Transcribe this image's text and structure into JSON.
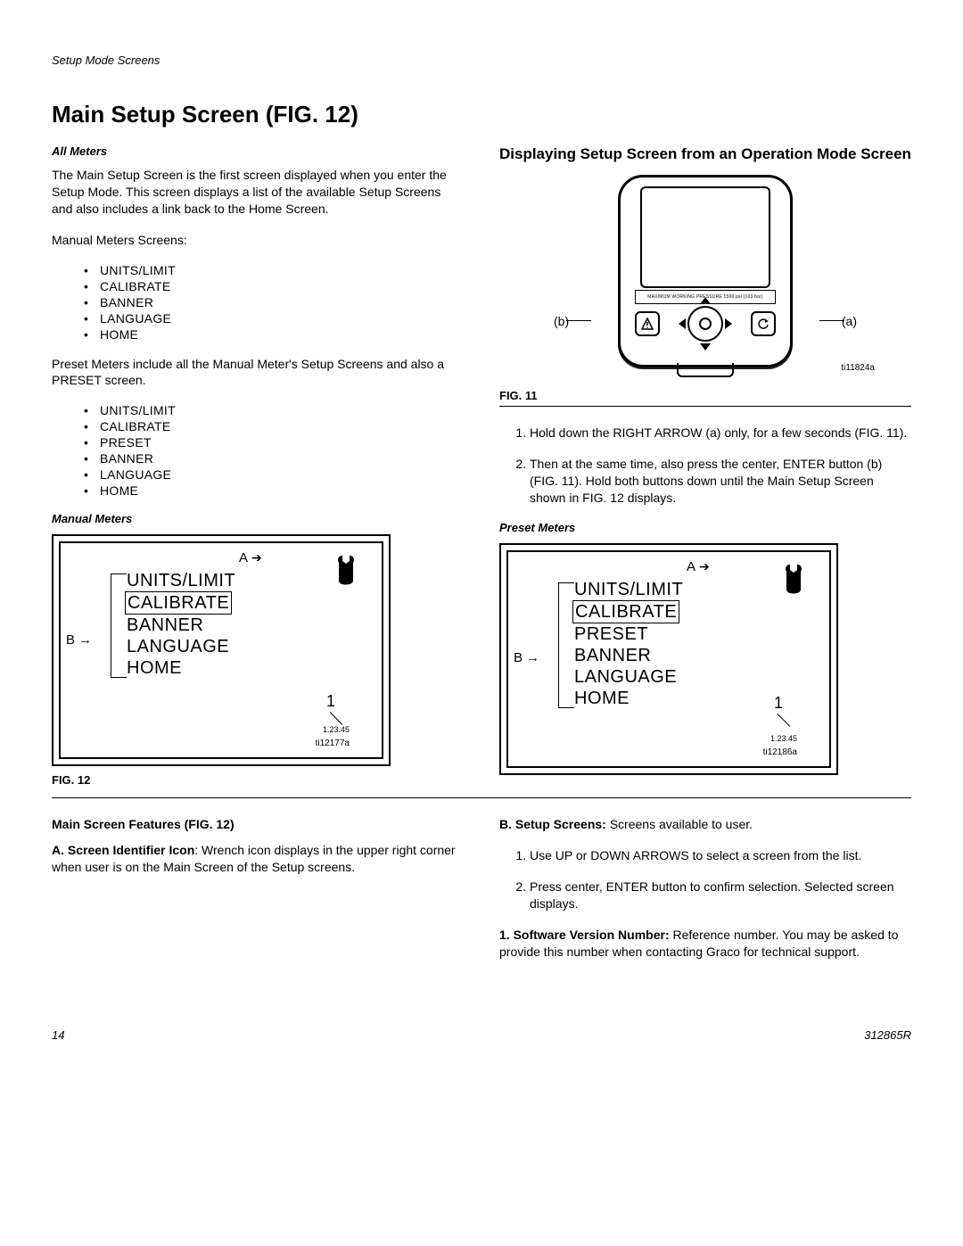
{
  "running_head": "Setup Mode Screens",
  "h1_pre": "Main Setup Screen (F",
  "h1_sc": "IG",
  "h1_post": ". 12)",
  "left": {
    "subhead1": "All Meters",
    "p1": "The Main Setup Screen is the first screen displayed when you enter the Setup Mode. This screen displays a list of the available Setup Screens and also includes a link back to the Home Screen.",
    "p2": "Manual Meters Screens:",
    "list1": [
      "UNITS/LIMIT",
      "CALIBRATE",
      "BANNER",
      "LANGUAGE",
      "HOME"
    ],
    "p3": "Preset Meters include all the Manual Meter's Setup Screens and also a PRESET screen.",
    "list2": [
      "UNITS/LIMIT",
      "CALIBRATE",
      "PRESET",
      "BANNER",
      "LANGUAGE",
      "HOME"
    ],
    "manual_title": "Manual Meters",
    "fig12_label": "FIG. 12",
    "features_title_pre": "Main Screen Features (F",
    "features_title_sc": "IG",
    "features_title_post": ". 12)",
    "feat_a_lead": "A. Screen Identifier Icon",
    "feat_a_rest": ": Wrench icon displays in the upper right corner when user is on the Main Screen of the Setup screens."
  },
  "right": {
    "h2": "Displaying Setup Screen from an Operation Mode Screen",
    "device_strip": "MAXIMUM WORKING PRESSURE 1500 psi (103 bar)",
    "lbl_a": "(a)",
    "lbl_b": "(b)",
    "ti11": "ti11824a",
    "fig11_label": "FIG. 11",
    "step1_pre": "Hold down the RIGHT ARROW (a) only, for a few seconds (F",
    "step1_sc": "IG",
    "step1_post": ". 11).",
    "step2_pre": "Then at the same time, also press the center, ENTER button (b) (F",
    "step2_sc1": "IG",
    "step2_mid": ". 11). Hold both buttons down until the Main Setup Screen shown in F",
    "step2_sc2": "IG",
    "step2_post": ". 12 displays.",
    "preset_title": "Preset Meters",
    "feat_b_lead": "B. Setup Screens:",
    "feat_b_rest": " Screens available to user.",
    "use1": "Use UP or DOWN ARROWS to select a screen from the list.",
    "use2": "Press center, ENTER button to confirm selection. Selected screen displays.",
    "sw_lead": "1. Software Version Number:",
    "sw_rest": " Reference number. You may be asked to provide this number when contacting Graco for technical support."
  },
  "screens": {
    "manual": {
      "A": "A",
      "B": "B",
      "num1": "1",
      "ver": "1.23.45",
      "ti": "ti12177a",
      "items": [
        "UNITS/LIMIT",
        "CALIBRATE",
        "BANNER",
        "LANGUAGE",
        "HOME"
      ],
      "boxed_index": 1
    },
    "preset": {
      "A": "A",
      "B": "B",
      "num1": "1",
      "ver": "1.23.45",
      "ti": "ti12186a",
      "items": [
        "UNITS/LIMIT",
        "CALIBRATE",
        "PRESET",
        "BANNER",
        "LANGUAGE",
        "HOME"
      ],
      "boxed_index": 1
    }
  },
  "footer": {
    "page": "14",
    "doc": "312865R"
  }
}
